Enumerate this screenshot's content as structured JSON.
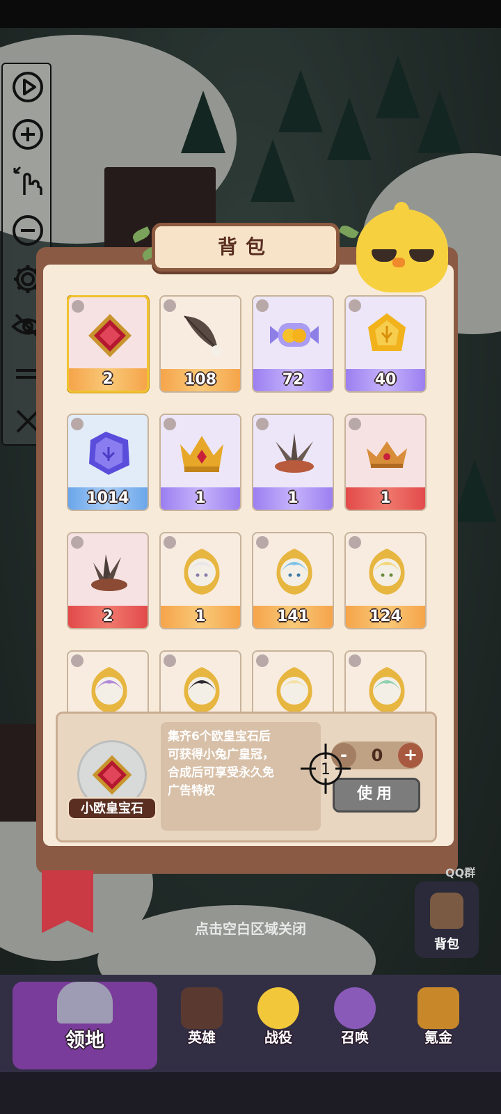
{
  "panel": {
    "title": "背包"
  },
  "items": [
    {
      "count": "2",
      "icon": "ruby-gem-icon",
      "rarity": "orange"
    },
    {
      "count": "108",
      "icon": "feather-icon",
      "rarity": "orange"
    },
    {
      "count": "72",
      "icon": "candy-icon",
      "rarity": "purple"
    },
    {
      "count": "40",
      "icon": "gold-crystal-icon",
      "rarity": "purple"
    },
    {
      "count": "1014",
      "icon": "blue-crystal-icon",
      "rarity": "blue"
    },
    {
      "count": "1",
      "icon": "gold-crown-icon",
      "rarity": "purple"
    },
    {
      "count": "1",
      "icon": "feather-crown-icon",
      "rarity": "purple"
    },
    {
      "count": "1",
      "icon": "small-crown-icon",
      "rarity": "red"
    },
    {
      "count": "2",
      "icon": "feather-nest-icon",
      "rarity": "red"
    },
    {
      "count": "1",
      "icon": "hero-portrait-icon",
      "rarity": "orange"
    },
    {
      "count": "141",
      "icon": "hero-portrait-icon",
      "rarity": "orange"
    },
    {
      "count": "124",
      "icon": "hero-portrait-icon",
      "rarity": "orange"
    },
    {
      "count": "",
      "icon": "hero-portrait-icon",
      "rarity": "orange"
    },
    {
      "count": "",
      "icon": "hero-portrait-icon",
      "rarity": "orange"
    },
    {
      "count": "",
      "icon": "hero-portrait-icon",
      "rarity": "orange"
    },
    {
      "count": "",
      "icon": "hero-portrait-icon",
      "rarity": "orange"
    }
  ],
  "detail": {
    "item_name": "小欧皇宝石",
    "description": [
      "集齐6个欧皇宝石后",
      "可获得小兔广皇冠，",
      "合成后可享受永久免",
      "广告特权"
    ],
    "quantity": "0",
    "minus_label": "-",
    "plus_label": "+",
    "use_label": "使用",
    "crosshair_number": "1"
  },
  "close_hint": "点击空白区域关闭",
  "side": {
    "qq_label": "QQ群",
    "backpack_label": "背包"
  },
  "nav": {
    "home_label": "领地",
    "items": [
      "英雄",
      "战役",
      "召唤",
      "氪金"
    ]
  },
  "toolbar": [
    "play-icon",
    "zoom-in-icon",
    "touch-gesture-icon",
    "zoom-out-icon",
    "settings-gear-icon",
    "hide-eye-icon",
    "drag-handle-icon",
    "close-icon"
  ],
  "colors": {
    "panel_bg": "#f7ead9",
    "panel_frame": "#8a5a44",
    "selected_border": "#f0c22e",
    "use_button": "#7c7c7c",
    "nav_bg": "#322f45"
  }
}
